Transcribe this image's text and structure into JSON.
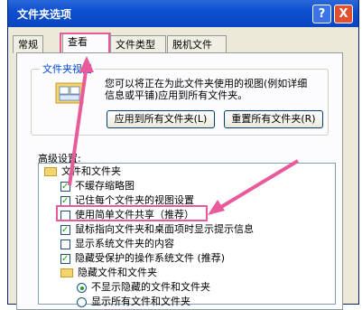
{
  "window": {
    "title": "文件夹选项",
    "help": "?",
    "close": "X"
  },
  "tabs": [
    {
      "label": "常规"
    },
    {
      "label": "查看"
    },
    {
      "label": "文件类型"
    },
    {
      "label": "脱机文件"
    }
  ],
  "folder_view": {
    "title": "文件夹视图",
    "description": "您可以将正在为此文件夹使用的视图(例如详细信息或平铺)应用到所有文件夹。",
    "apply_button": "应用到所有文件夹(L)",
    "reset_button": "重置所有文件夹(R)"
  },
  "advanced": {
    "label": "高级设置:",
    "items": [
      {
        "type": "folder",
        "label": "文件和文件夹"
      },
      {
        "type": "checkbox",
        "checked": true,
        "label": "不缓存缩略图"
      },
      {
        "type": "checkbox",
        "checked": true,
        "label": "记住每个文件夹的视图设置"
      },
      {
        "type": "checkbox",
        "checked": false,
        "label": "使用简单文件共享（推荐）"
      },
      {
        "type": "checkbox",
        "checked": true,
        "label": "鼠标指向文件夹和桌面项时显示提示信息"
      },
      {
        "type": "checkbox",
        "checked": false,
        "label": "显示系统文件夹的内容"
      },
      {
        "type": "checkbox",
        "checked": true,
        "label": "隐藏受保护的操作系统文件 (推荐)"
      },
      {
        "type": "folder",
        "label": "隐藏文件和文件夹"
      },
      {
        "type": "radio",
        "checked": true,
        "label": "不显示隐藏的文件和文件夹"
      },
      {
        "type": "radio",
        "checked": false,
        "label": "显示所有文件和文件夹"
      }
    ]
  },
  "colors": {
    "annotation": "#e85a9a",
    "titlebar": "#0c4fd0"
  }
}
